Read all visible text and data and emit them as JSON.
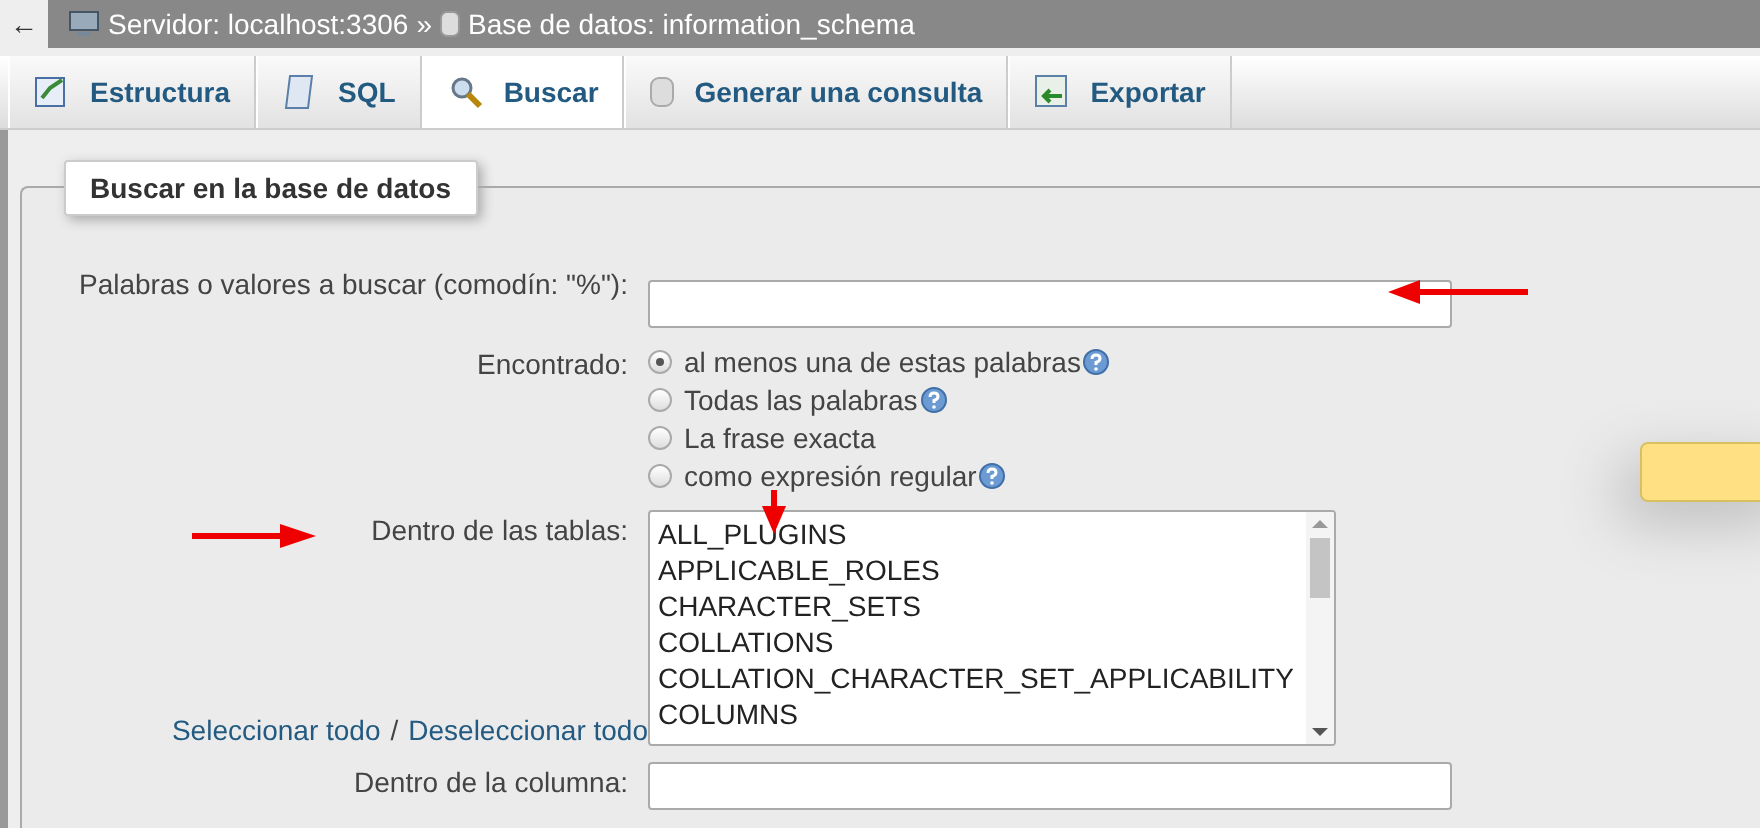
{
  "breadcrumb": {
    "back": "←",
    "server": "Servidor: localhost:3306",
    "separator": "»",
    "database": "Base de datos: information_schema"
  },
  "tabs": [
    {
      "label": "Estructura",
      "selected": false
    },
    {
      "label": "SQL",
      "selected": false
    },
    {
      "label": "Buscar",
      "selected": true
    },
    {
      "label": "Generar una consulta",
      "selected": false
    },
    {
      "label": "Exportar",
      "selected": false
    }
  ],
  "form": {
    "legend": "Buscar en la base de datos",
    "search_label": "Palabras o valores a buscar (comodín: \"%\"):",
    "found_label": "Encontrado:",
    "options": [
      {
        "label": "al menos una de estas palabras",
        "selected": true,
        "help": true
      },
      {
        "label": "Todas las palabras",
        "selected": false,
        "help": true
      },
      {
        "label": "La frase exacta",
        "selected": false,
        "help": false
      },
      {
        "label": "como expresión regular",
        "selected": false,
        "help": true
      }
    ],
    "tables_label": "Dentro de las tablas:",
    "tables": [
      "ALL_PLUGINS",
      "APPLICABLE_ROLES",
      "CHARACTER_SETS",
      "COLLATIONS",
      "COLLATION_CHARACTER_SET_APPLICABILITY",
      "COLUMNS"
    ],
    "select_all": "Seleccionar todo",
    "slash": "/",
    "deselect_all": "Deseleccionar todo",
    "column_label": "Dentro de la columna:"
  }
}
